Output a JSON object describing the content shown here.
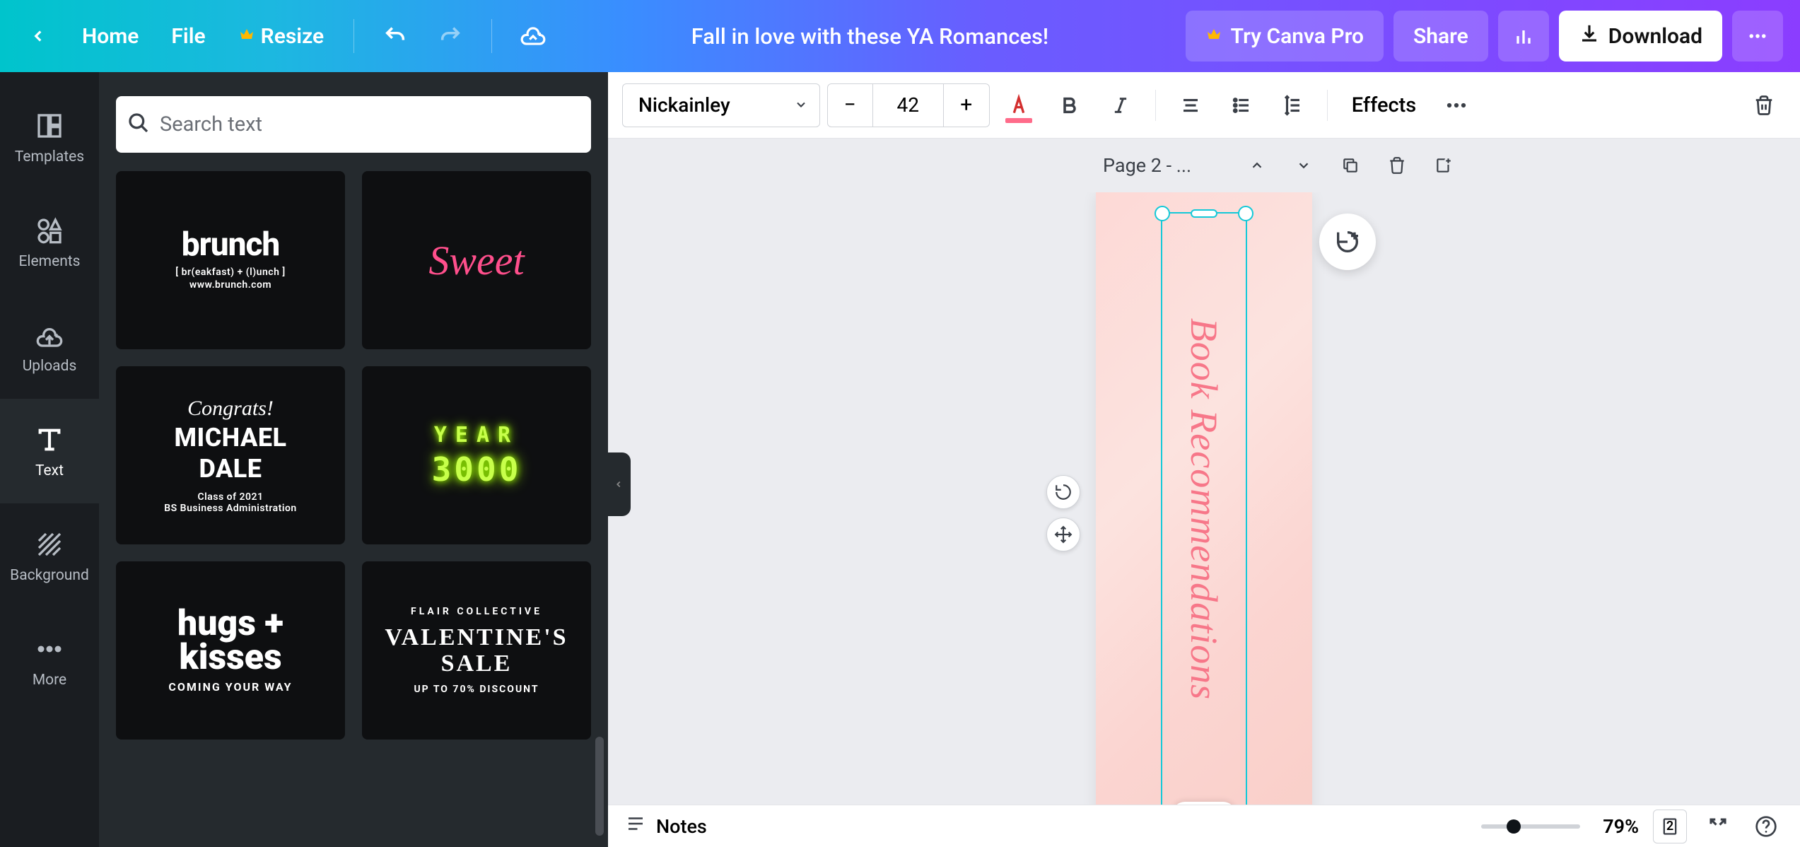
{
  "topbar": {
    "home": "Home",
    "file": "File",
    "resize": "Resize",
    "title": "Fall in love with these YA Romances!",
    "try_pro": "Try Canva Pro",
    "share": "Share",
    "download": "Download"
  },
  "rail": {
    "templates": "Templates",
    "elements": "Elements",
    "uploads": "Uploads",
    "text": "Text",
    "background": "Background",
    "more": "More"
  },
  "search": {
    "placeholder": "Search text"
  },
  "text_templates": [
    {
      "line1": "brunch",
      "line2": "[ br(eakfast) + (l)unch ]",
      "line3": "www.brunch.com"
    },
    {
      "line1": "Sweet"
    },
    {
      "script": "Congrats!",
      "name1": "MICHAEL",
      "name2": "DALE",
      "sub1": "Class of 2021",
      "sub2": "BS Business Administration"
    },
    {
      "year": "YEAR",
      "num": "3000"
    },
    {
      "l1": "hugs +",
      "l2": "kisses",
      "sub": "COMING YOUR WAY"
    },
    {
      "top": "FLAIR COLLECTIVE",
      "l1": "VALENTINE'S",
      "l2": "SALE",
      "sub": "UP TO 70% DISCOUNT"
    }
  ],
  "ctx": {
    "font": "Nickainley",
    "size": "42",
    "effects": "Effects"
  },
  "colors": {
    "text_underline": "#ff6b8a",
    "selection": "#13c9d8",
    "canvas_text": "#f77789"
  },
  "pagehdr": {
    "label": "Page 2 - ..."
  },
  "canvas": {
    "text": "Book Recommendations"
  },
  "footer": {
    "notes": "Notes",
    "zoom": "79%",
    "page_count": "2"
  }
}
